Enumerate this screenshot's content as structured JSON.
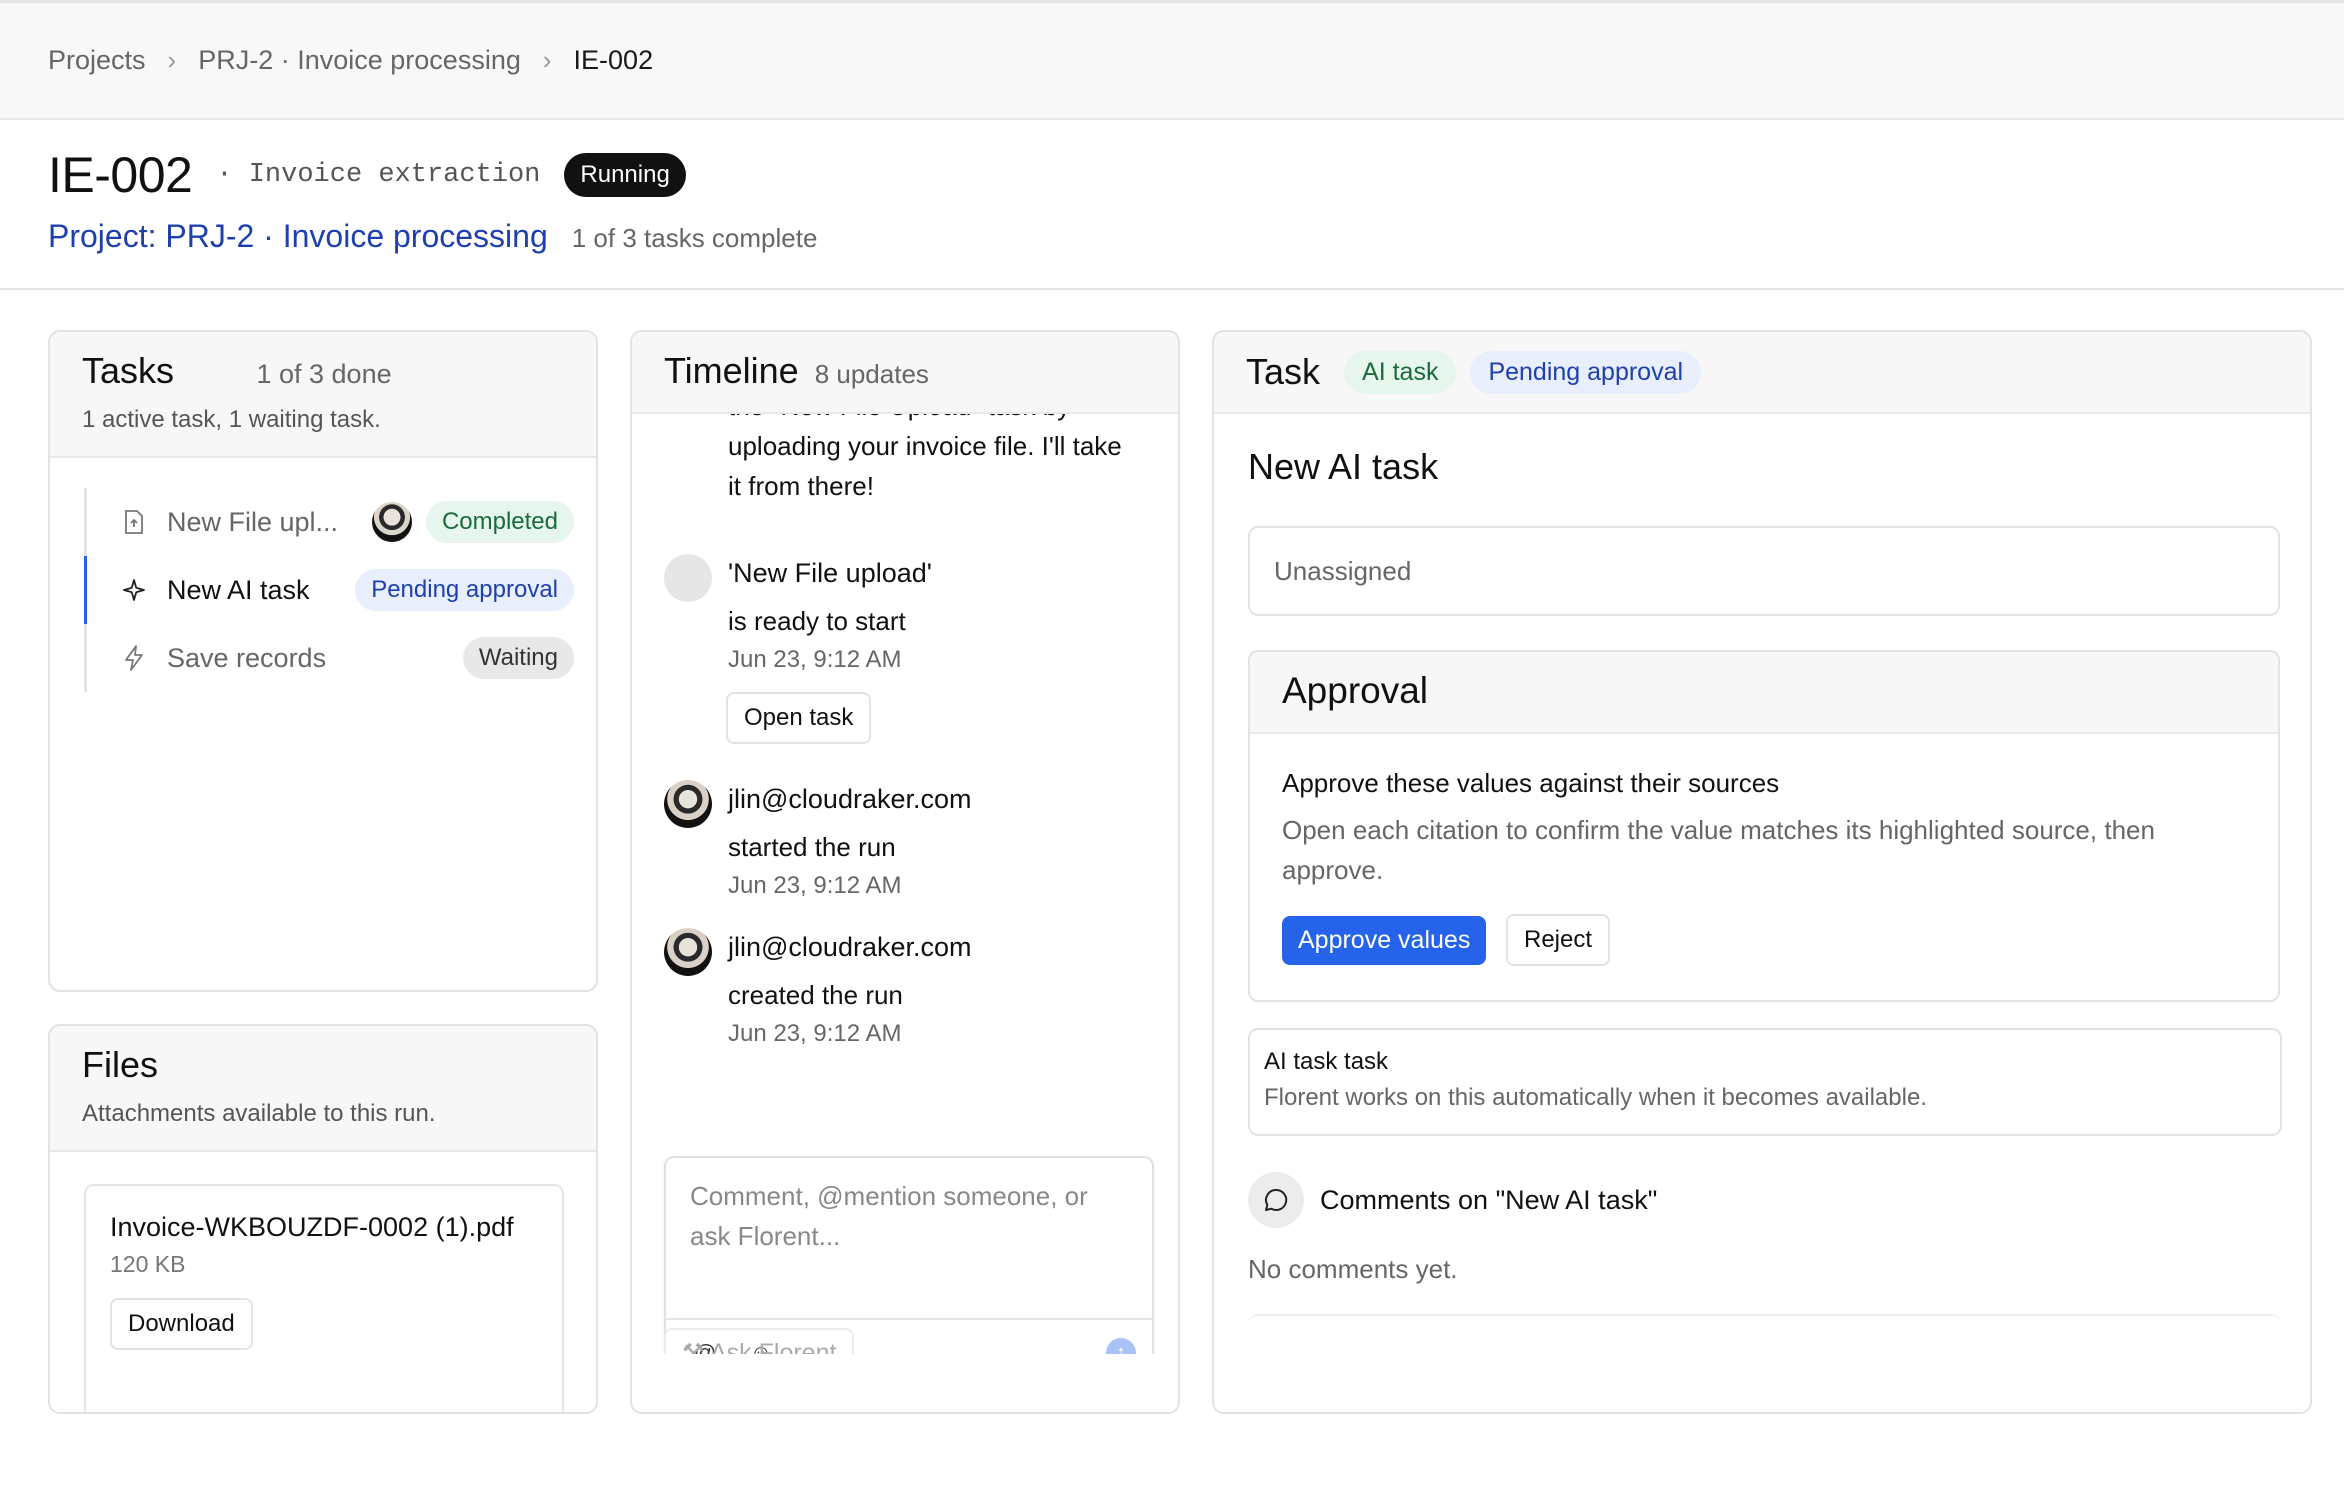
{
  "breadcrumb": {
    "items": [
      "Projects",
      "PRJ-2 · Invoice processing",
      "IE-002"
    ]
  },
  "header": {
    "run_id": "IE-002",
    "run_type": "· Invoice extraction",
    "status": "Running",
    "project_link": "Project: PRJ-2 · Invoice processing",
    "progress": "1 of 3 tasks complete"
  },
  "tasks_panel": {
    "title": "Tasks",
    "count": "1 of 3 done",
    "subtitle": "1 active task, 1 waiting task.",
    "items": [
      {
        "label": "New File upl...",
        "icon": "file-upload-icon",
        "status": "Completed",
        "has_avatar": true
      },
      {
        "label": "New AI task",
        "icon": "sparkle-icon",
        "status": "Pending approval",
        "active": true
      },
      {
        "label": "Save records",
        "icon": "lightning-icon",
        "status": "Waiting"
      }
    ]
  },
  "files_panel": {
    "title": "Files",
    "subtitle": "Attachments available to this run.",
    "files": [
      {
        "name": "Invoice-WKBOUZDF-0002 (1).pdf",
        "size": "120 KB",
        "action": "Download"
      }
    ]
  },
  "timeline": {
    "title": "Timeline",
    "count": "8 updates",
    "partial_message": "the \"New File Upload\" task by uploading your invoice file. I'll take it from there!",
    "entries": [
      {
        "line1": "'New File upload'",
        "line2": "is ready to start",
        "time": "Jun 23, 9:12 AM",
        "action": "Open task"
      },
      {
        "line1": "jlin@cloudraker.com",
        "line2": "started the run",
        "time": "Jun 23, 9:12 AM"
      },
      {
        "line1": "jlin@cloudraker.com",
        "line2": "created the run",
        "time": "Jun 23, 9:12 AM"
      }
    ],
    "composer_placeholder": "Comment, @mention someone, or ask Florent...",
    "ask_button": "Ask Florent"
  },
  "task_panel": {
    "title": "Task",
    "tag_type": "AI task",
    "tag_status": "Pending approval",
    "task_name": "New AI task",
    "assignee": "Unassigned",
    "approval": {
      "title": "Approval",
      "heading": "Approve these values against their sources",
      "description": "Open each citation to confirm the value matches its highlighted source, then approve.",
      "approve_label": "Approve values",
      "reject_label": "Reject"
    },
    "ai_task": {
      "title": "AI task task",
      "description": "Florent works on this automatically when it becomes available."
    },
    "comments_title": "Comments on \"New AI task\"",
    "no_comments": "No comments yet."
  },
  "colors": {
    "accent": "#2563eb",
    "link": "#1e40af",
    "completed_bg": "#e6f6ec",
    "pending_bg": "#e8eefc",
    "running_bg": "#111111"
  }
}
